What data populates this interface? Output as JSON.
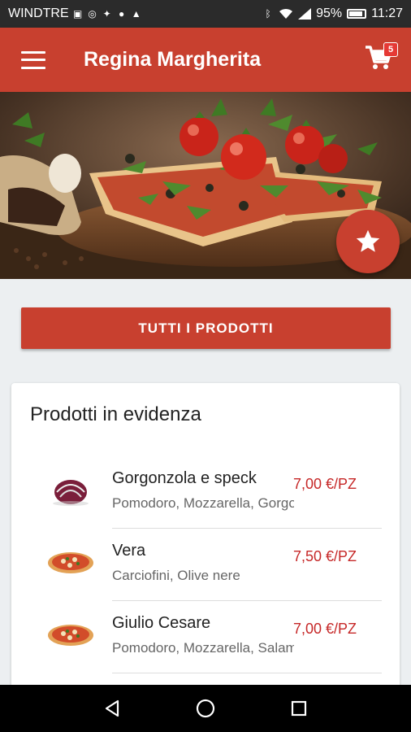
{
  "status_bar": {
    "carrier": "WINDTRE",
    "battery": "95%",
    "time": "11:27",
    "icons": [
      "message-icon",
      "instagram-icon",
      "twitter-icon",
      "facebook-icon",
      "drive-icon",
      "bluetooth-icon",
      "wifi-icon",
      "signal-icon",
      "battery-icon"
    ]
  },
  "app_bar": {
    "title": "Regina Margherita",
    "cart_count": "5",
    "accent": "#c8402f"
  },
  "hero": {
    "image": "pizza-photo",
    "fab_icon": "star-icon"
  },
  "all_products_button": "TUTTI I PRODOTTI",
  "featured": {
    "title": "Prodotti in evidenza",
    "products": [
      {
        "name": "Gorgonzola e speck",
        "description": "Pomodoro, Mozzarella, Gorgonzola, Speck",
        "price": "7,00 €/PZ",
        "thumb": "radicchio-image"
      },
      {
        "name": "Vera",
        "description": "Carciofini, Olive nere",
        "price": "7,50 €/PZ",
        "thumb": "pizza-image"
      },
      {
        "name": "Giulio Cesare",
        "description": "Pomodoro, Mozzarella, Salame",
        "price": "7,00 €/PZ",
        "thumb": "pizza-image"
      }
    ]
  },
  "nav_bar": {
    "icons": [
      "back-icon",
      "home-icon",
      "recents-icon"
    ]
  }
}
